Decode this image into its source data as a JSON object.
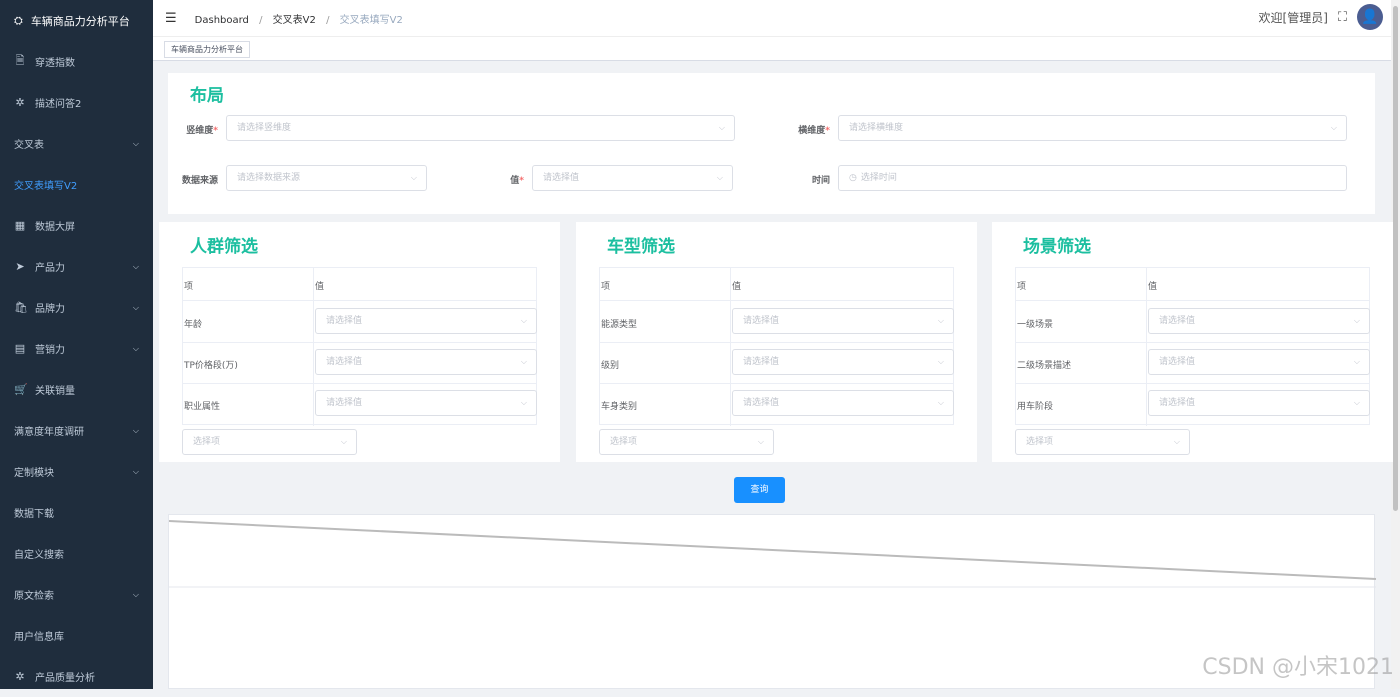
{
  "app": {
    "title": "车辆商品力分析平台"
  },
  "sidebar": {
    "items": [
      {
        "label": "穿透指数",
        "icon": "doc-icon",
        "chevron": false
      },
      {
        "label": "描述问答2",
        "icon": "sparkle-icon",
        "chevron": false
      },
      {
        "label": "交叉表",
        "icon": "",
        "chevron": true
      },
      {
        "label": "交叉表填写V2",
        "icon": "",
        "chevron": false,
        "active": true
      },
      {
        "label": "数据大屏",
        "icon": "grid-icon",
        "chevron": false
      },
      {
        "label": "产品力",
        "icon": "send-icon",
        "chevron": true
      },
      {
        "label": "品牌力",
        "icon": "bag-icon",
        "chevron": true
      },
      {
        "label": "营销力",
        "icon": "calendar-icon",
        "chevron": true
      },
      {
        "label": "关联销量",
        "icon": "cart-icon",
        "chevron": false
      },
      {
        "label": "满意度年度调研",
        "icon": "",
        "chevron": true
      },
      {
        "label": "定制模块",
        "icon": "",
        "chevron": true
      },
      {
        "label": "数据下载",
        "icon": "",
        "chevron": false
      },
      {
        "label": "自定义搜索",
        "icon": "",
        "chevron": false
      },
      {
        "label": "原文检索",
        "icon": "",
        "chevron": true
      },
      {
        "label": "用户信息库",
        "icon": "",
        "chevron": false
      },
      {
        "label": "产品质量分析",
        "icon": "sparkle-icon",
        "chevron": false
      }
    ]
  },
  "header": {
    "breadcrumb": [
      "Dashboard",
      "交叉表V2",
      "交叉表填写V2"
    ],
    "welcome": "欢迎[管理员]"
  },
  "tags": {
    "active": "车辆商品力分析平台"
  },
  "layout_section": {
    "title": "布局",
    "vertical_label": "竖维度",
    "vertical_placeholder": "请选择竖维度",
    "horizontal_label": "横维度",
    "horizontal_placeholder": "请选择横维度",
    "source_label": "数据来源",
    "source_placeholder": "请选择数据来源",
    "value_label": "值",
    "value_placeholder": "请选择值",
    "time_label": "时间",
    "time_placeholder": "选择时间"
  },
  "filters": [
    {
      "title": "人群筛选",
      "col_item": "项",
      "col_value": "值",
      "rows": [
        {
          "item": "年龄",
          "placeholder": "请选择值"
        },
        {
          "item": "TP价格段(万)",
          "placeholder": "请选择值"
        },
        {
          "item": "职业属性",
          "placeholder": "请选择值"
        }
      ],
      "extra_placeholder": "选择项"
    },
    {
      "title": "车型筛选",
      "col_item": "项",
      "col_value": "值",
      "rows": [
        {
          "item": "能源类型",
          "placeholder": "请选择值"
        },
        {
          "item": "级别",
          "placeholder": "请选择值"
        },
        {
          "item": "车身类别",
          "placeholder": "请选择值"
        }
      ],
      "extra_placeholder": "选择项"
    },
    {
      "title": "场景筛选",
      "col_item": "项",
      "col_value": "值",
      "rows": [
        {
          "item": "一级场景",
          "placeholder": "请选择值"
        },
        {
          "item": "二级场景描述",
          "placeholder": "请选择值"
        },
        {
          "item": "用车阶段",
          "placeholder": "请选择值"
        }
      ],
      "extra_placeholder": "选择项"
    }
  ],
  "query_button": "查询",
  "watermark": "CSDN @小宋1021"
}
